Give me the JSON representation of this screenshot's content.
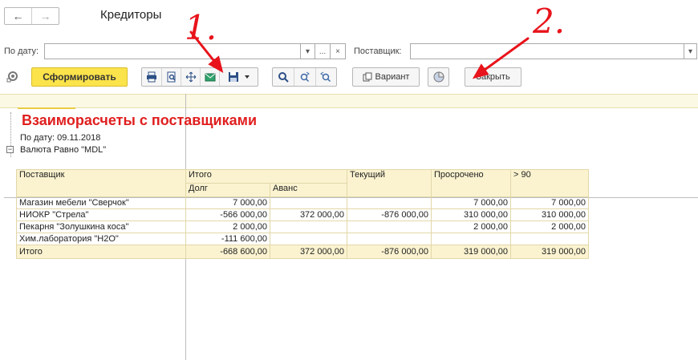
{
  "window": {
    "title": "Кредиторы"
  },
  "nav": {
    "back": "←",
    "forward": "→"
  },
  "filters": {
    "date_label": "По дату:",
    "date_value": "",
    "dropdown_glyph": "▾",
    "ellipsis": "...",
    "clear": "×",
    "supplier_label": "Поставщик:",
    "supplier_value": ""
  },
  "toolbar": {
    "form_label": "Сформировать",
    "variant_label": "Вариант",
    "close_label": "Закрыть",
    "icons": [
      "print-icon",
      "preview-icon",
      "pan-icon",
      "email-icon",
      "save-icon",
      "search-icon",
      "find-next-icon",
      "find-prev-icon"
    ]
  },
  "report": {
    "title": "Взаиморасчеты с поставщиками",
    "param_date": "По дату: 09.11.2018",
    "param_currency": "Валюта Равно \"MDL\"",
    "headers": {
      "supplier": "Поставщик",
      "total": "Итого",
      "debt": "Долг",
      "advance": "Аванс",
      "current": "Текущий",
      "overdue": "Просрочено",
      "over90": "> 90"
    },
    "rows": [
      {
        "supplier": "Магазин мебели \"Сверчок\"",
        "debt": "7 000,00",
        "advance": "",
        "current": "",
        "overdue": "7 000,00",
        "over90": "7 000,00"
      },
      {
        "supplier": "НИОКР \"Стрела\"",
        "debt": "-566 000,00",
        "advance": "372 000,00",
        "current": "-876 000,00",
        "overdue": "310 000,00",
        "over90": "310 000,00"
      },
      {
        "supplier": "Пекарня \"Золушкина коса\"",
        "debt": "2 000,00",
        "advance": "",
        "current": "",
        "overdue": "2 000,00",
        "over90": "2 000,00"
      },
      {
        "supplier": "Хим.лаборатория \"H2O\"",
        "debt": "-111 600,00",
        "advance": "",
        "current": "",
        "overdue": "",
        "over90": ""
      }
    ],
    "total": {
      "label": "Итого",
      "debt": "-668 600,00",
      "advance": "372 000,00",
      "current": "-876 000,00",
      "overdue": "319 000,00",
      "over90": "319 000,00"
    }
  },
  "annotations": {
    "one": "1.",
    "two": "2."
  },
  "colors": {
    "accent_yellow": "#fbe34b",
    "title_red": "#e01e1e",
    "annotation_red": "#e8131b",
    "report_band": "#fbf8e3"
  }
}
